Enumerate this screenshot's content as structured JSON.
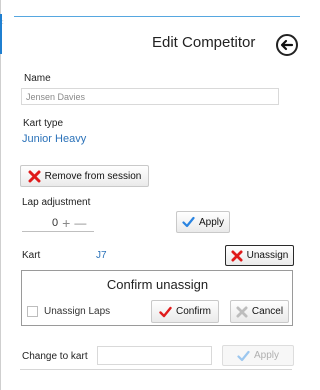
{
  "window": {
    "left_dots": ":"
  },
  "header": {
    "title": "Edit Competitor"
  },
  "name_section": {
    "label": "Name",
    "value": "Jensen Davies"
  },
  "kart_type_section": {
    "label": "Kart type",
    "value": "Junior Heavy"
  },
  "remove_button": {
    "label": "Remove from session"
  },
  "lap_adjustment": {
    "label": "Lap adjustment",
    "value": "0",
    "plus": "+",
    "minus": "—"
  },
  "apply_button": {
    "label": "Apply"
  },
  "kart_section": {
    "label": "Kart",
    "value": "J7"
  },
  "unassign_button": {
    "label": "Unassign"
  },
  "confirm_unassign": {
    "title": "Confirm unassign",
    "checkbox_label": "Unassign Laps",
    "checked": false,
    "confirm_label": "Confirm",
    "cancel_label": "Cancel"
  },
  "change_kart": {
    "label": "Change to kart",
    "value": "",
    "apply_label": "Apply"
  },
  "colors": {
    "accent_blue": "#2b72b9",
    "red_x": "#e01b1b",
    "blue_check": "#2a84e1"
  }
}
